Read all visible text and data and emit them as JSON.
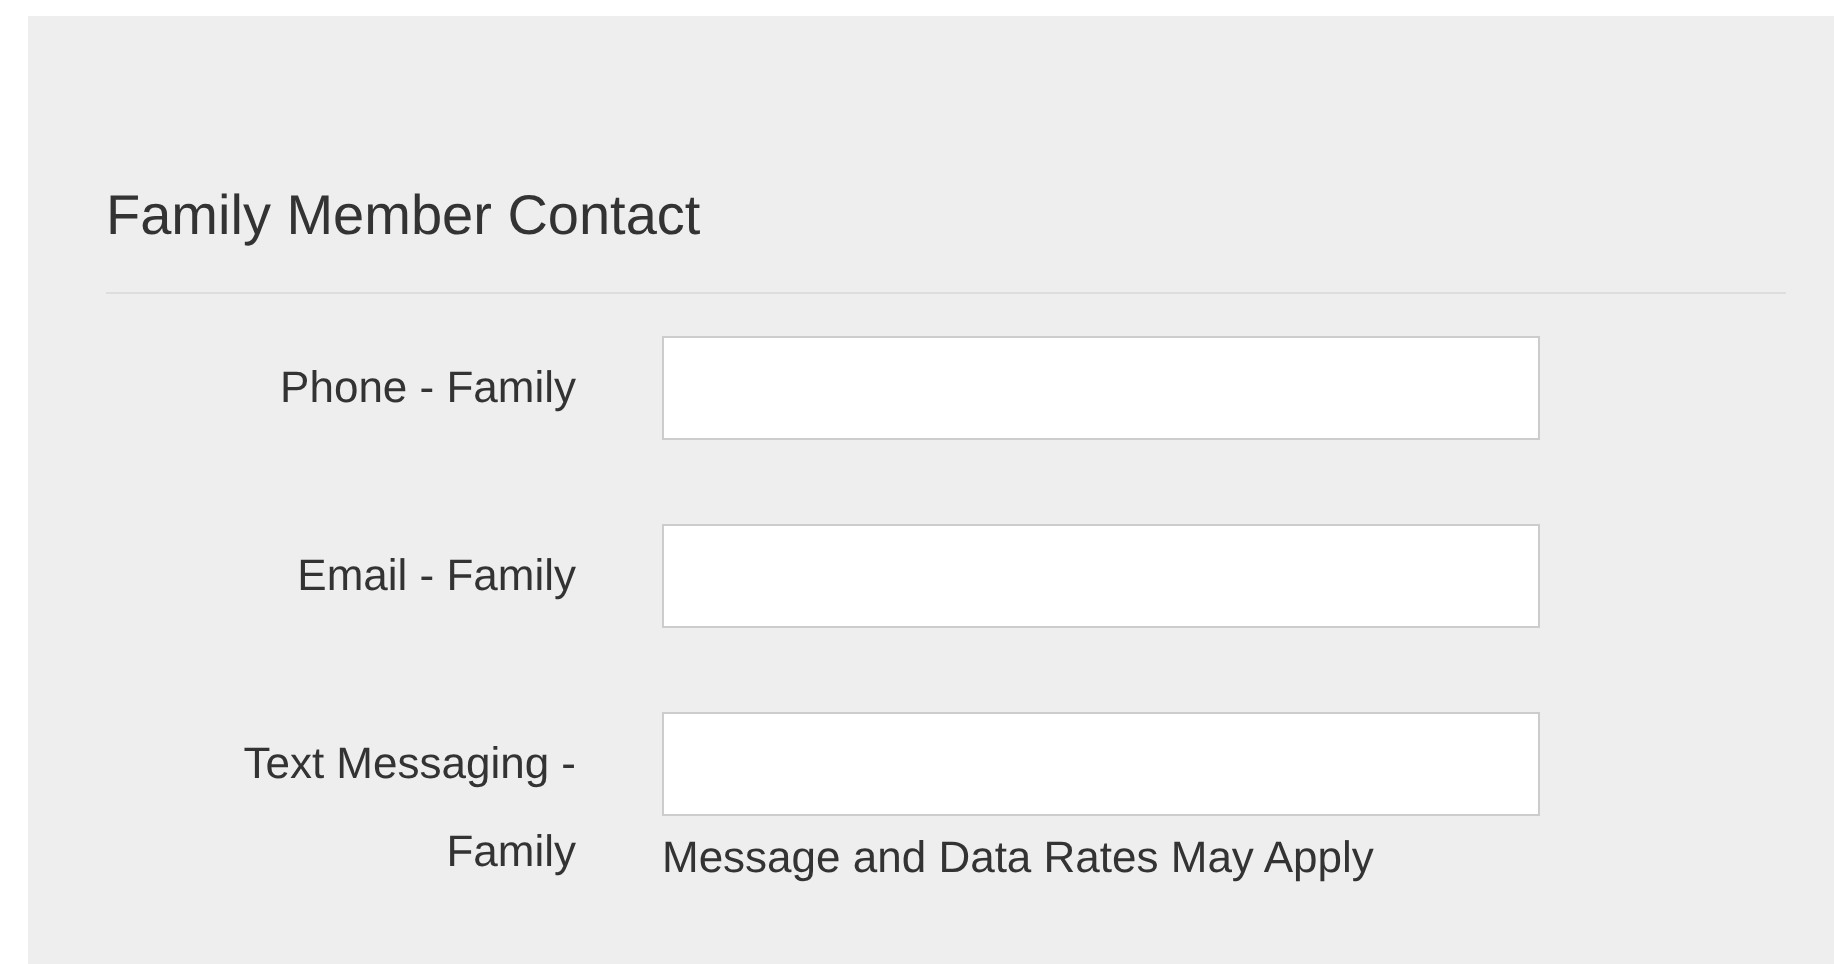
{
  "section": {
    "title": "Family Member Contact"
  },
  "fields": [
    {
      "label": "Phone - Family"
    },
    {
      "label": "Email - Family"
    },
    {
      "label": "Text Messaging - Family",
      "help": "Message and Data Rates May Apply"
    }
  ]
}
